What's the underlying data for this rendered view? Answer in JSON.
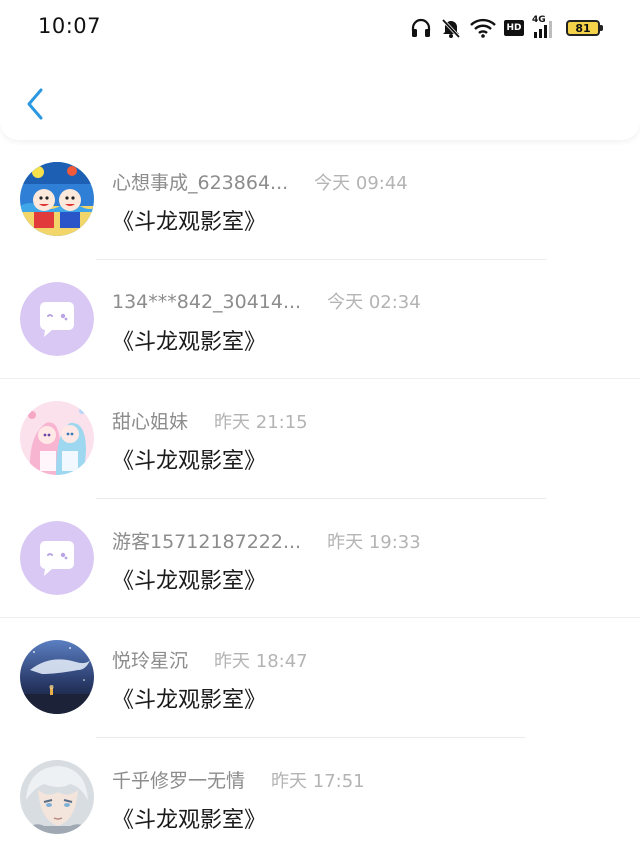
{
  "status_bar": {
    "time": "10:07",
    "network_label": "4G",
    "hd_label": "HD",
    "battery": "81"
  },
  "header": {
    "back_icon": "chevron-left-icon"
  },
  "colors": {
    "accent": "#2a97e0",
    "avatar_default_bg": "#d9c8f3",
    "name_text": "#8c8c8c",
    "time_text": "#b4b4b4"
  },
  "messages": [
    {
      "name": "心想事成_623864...",
      "time": "今天 09:44",
      "text": "《斗龙观影室》",
      "avatar": "cartoon-avatar"
    },
    {
      "name": "134***842_30414...",
      "time": "今天 02:34",
      "text": "《斗龙观影室》",
      "avatar": "default-chat-avatar"
    },
    {
      "name": "甜心姐妹",
      "time": "昨天 21:15",
      "text": "《斗龙观影室》",
      "avatar": "anime-girls-avatar"
    },
    {
      "name": "游客15712187222...",
      "time": "昨天 19:33",
      "text": "《斗龙观影室》",
      "avatar": "default-chat-avatar"
    },
    {
      "name": "悦玲星沉",
      "time": "昨天 18:47",
      "text": "《斗龙观影室》",
      "avatar": "night-whale-avatar"
    },
    {
      "name": "千乎修罗一无情",
      "time": "昨天 17:51",
      "text": "《斗龙观影室》",
      "avatar": "anime-boy-avatar"
    }
  ]
}
